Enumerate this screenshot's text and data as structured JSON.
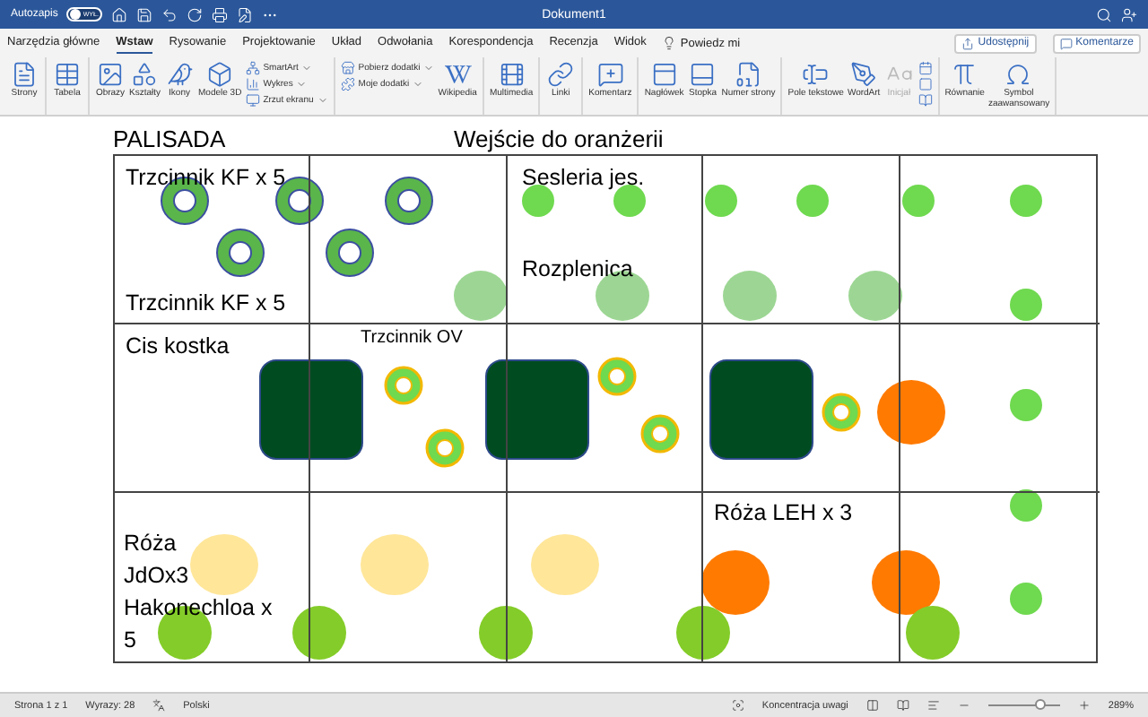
{
  "window": {
    "autosave_label": "Autozapis",
    "autosave": {
      "on": false,
      "label": "WYŁ."
    },
    "title": "Dokument1"
  },
  "tabs": [
    {
      "label": "Narzędzia główne",
      "selected": false
    },
    {
      "label": "Wstaw",
      "selected": true
    },
    {
      "label": "Rysowanie",
      "selected": false
    },
    {
      "label": "Projektowanie",
      "selected": false
    },
    {
      "label": "Układ",
      "selected": false
    },
    {
      "label": "Odwołania",
      "selected": false
    },
    {
      "label": "Korespondencja",
      "selected": false
    },
    {
      "label": "Recenzja",
      "selected": false
    },
    {
      "label": "Widok",
      "selected": false
    }
  ],
  "tell_me": "Powiedz mi",
  "share_button": "Udostępnij",
  "comments_button": "Komentarze",
  "ribbon": [
    {
      "items": [
        {
          "kind": "large",
          "label": "Strony",
          "disabled": false
        }
      ]
    },
    {
      "items": [
        {
          "kind": "large",
          "label": "Tabela",
          "disabled": false
        }
      ]
    },
    {
      "items": [
        {
          "kind": "large",
          "label": "Obrazy",
          "disabled": false
        },
        {
          "kind": "large",
          "label": "Kształty",
          "disabled": false
        },
        {
          "kind": "large",
          "label": "Ikony",
          "disabled": false
        },
        {
          "kind": "large",
          "label": "Modele 3D",
          "disabled": false
        },
        {
          "kind": "stack",
          "items": [
            {
              "label": "SmartArt"
            },
            {
              "label": "Wykres"
            },
            {
              "label": "Zrzut ekranu"
            }
          ]
        }
      ]
    },
    {
      "items": [
        {
          "kind": "stack",
          "items": [
            {
              "label": "Pobierz dodatki"
            },
            {
              "label": "Moje dodatki"
            }
          ]
        },
        {
          "kind": "large",
          "label": "Wikipedia",
          "disabled": false
        }
      ]
    },
    {
      "items": [
        {
          "kind": "large",
          "label": "Multimedia",
          "disabled": false
        }
      ]
    },
    {
      "items": [
        {
          "kind": "large",
          "label": "Linki",
          "disabled": false
        }
      ]
    },
    {
      "items": [
        {
          "kind": "large",
          "label": "Komentarz",
          "disabled": false
        }
      ]
    },
    {
      "items": [
        {
          "kind": "large",
          "label": "Nagłówek",
          "disabled": false
        },
        {
          "kind": "large",
          "label": "Stopka",
          "disabled": false
        },
        {
          "kind": "large",
          "label": "Numer strony",
          "disabled": false
        }
      ]
    },
    {
      "items": [
        {
          "kind": "large",
          "label": "Pole tekstowe",
          "disabled": false
        },
        {
          "kind": "large",
          "label": "WordArt",
          "disabled": false
        },
        {
          "kind": "large",
          "label": "Inicjał",
          "disabled": true
        },
        {
          "kind": "icons"
        }
      ]
    },
    {
      "items": [
        {
          "kind": "large",
          "label": "Równanie",
          "disabled": false
        },
        {
          "kind": "large",
          "label": "Symbol zaawansowany",
          "disabled": false
        }
      ]
    }
  ],
  "document": {
    "headings": [
      "PALISADA",
      "Wejście do oranżerii"
    ],
    "table": {
      "rows": [
        {
          "cells": [
            {
              "texts": [
                "Trzcinnik KF x 5",
                "Trzcinnik KF x 5"
              ]
            },
            {},
            {
              "texts": [
                "Sesleria jes.",
                "Rozplenica"
              ]
            },
            {},
            {}
          ]
        },
        {
          "cells": [
            {
              "texts": [
                "Cis kostka"
              ]
            },
            {
              "texts": [
                "Trzcinnik OV"
              ]
            },
            {},
            {},
            {}
          ]
        },
        {
          "cells": [
            {
              "texts": [
                "Róża",
                "JdOx3",
                "Hakonechloa x",
                "5"
              ]
            },
            {},
            {},
            {
              "texts": [
                "Róża LEH x 3"
              ]
            },
            {}
          ]
        }
      ]
    }
  },
  "status_bar": {
    "page": "Strona 1 z 1",
    "words": "Wyrazy: 28",
    "language": "Polski",
    "focus": "Koncentracja uwagi",
    "zoom": {
      "level": 0.72,
      "reading": "289%"
    }
  }
}
